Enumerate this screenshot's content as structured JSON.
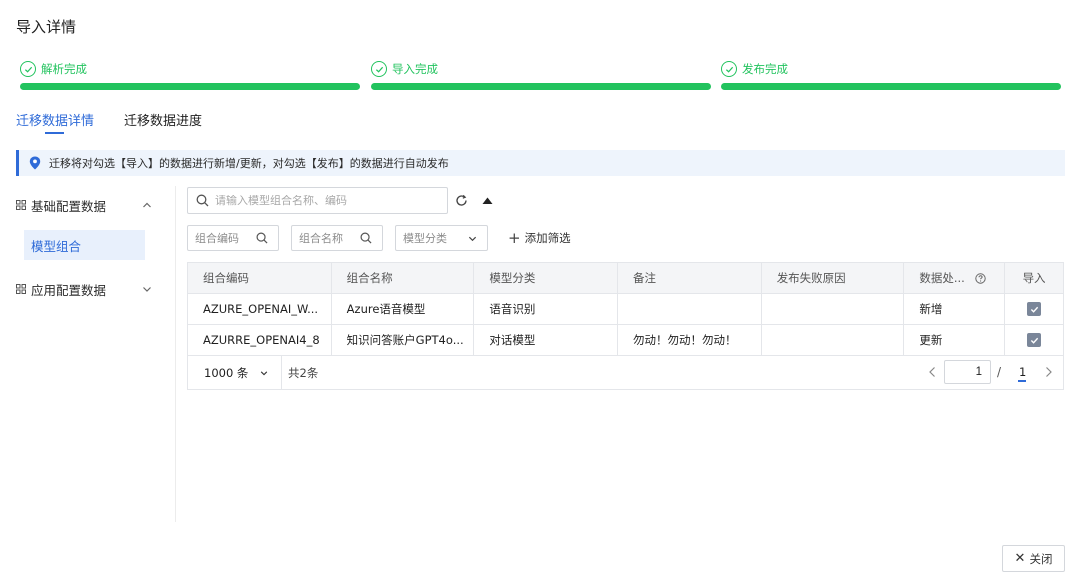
{
  "dialog": {
    "title": "导入详情",
    "close_label": "关闭"
  },
  "steps": [
    {
      "label": "解析完成",
      "status": "done"
    },
    {
      "label": "导入完成",
      "status": "done"
    },
    {
      "label": "发布完成",
      "status": "done"
    }
  ],
  "colors": {
    "success": "#22c35e",
    "accent": "#2f6bd8"
  },
  "tabs": [
    {
      "label": "迁移数据详情",
      "active": true
    },
    {
      "label": "迁移数据进度",
      "active": false
    }
  ],
  "notice": {
    "text": "迁移将对勾选【导入】的数据进行新增/更新，对勾选【发布】的数据进行自动发布"
  },
  "sidebar": {
    "groups": [
      {
        "label": "基础配置数据",
        "expanded": true,
        "items": [
          {
            "label": "模型组合",
            "selected": true
          }
        ]
      },
      {
        "label": "应用配置数据",
        "expanded": false,
        "items": []
      }
    ]
  },
  "toolbar": {
    "search_placeholder": "请输入模型组合名称、编码"
  },
  "filters": [
    {
      "label": "组合编码",
      "icon": "search-icon"
    },
    {
      "label": "组合名称",
      "icon": "search-icon"
    },
    {
      "label": "模型分类",
      "icon": "chevron-down-icon"
    }
  ],
  "add_filter_label": "添加筛选",
  "table": {
    "columns": [
      "组合编码",
      "组合名称",
      "模型分类",
      "备注",
      "发布失败原因",
      "数据处...",
      "导入"
    ],
    "rows": [
      {
        "code": "AZURE_OPENAI_W...",
        "name": "Azure语音模型",
        "category": "语音识别",
        "remark": "",
        "fail_reason": "",
        "action": "新增",
        "import": true
      },
      {
        "code": "AZURRE_OPENAI4_8",
        "name": "知识问答账户GPT4o...",
        "category": "对话模型",
        "remark": "勿动！勿动！勿动！",
        "fail_reason": "",
        "action": "更新",
        "import": true
      }
    ]
  },
  "pagination": {
    "page_size": "1000 条",
    "total": "共2条",
    "current_page": "1",
    "separator": "/",
    "total_pages": "1"
  }
}
